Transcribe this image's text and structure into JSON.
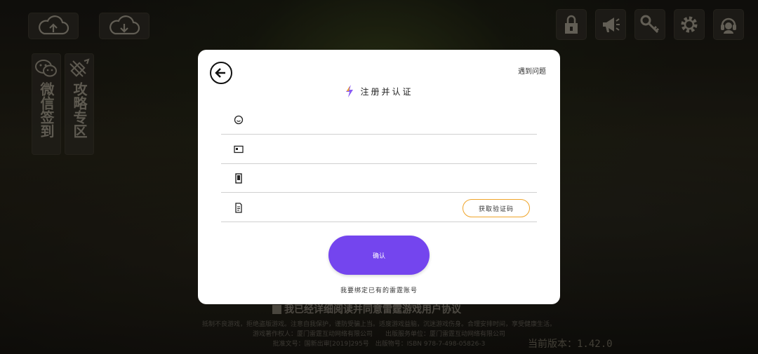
{
  "background": {
    "upload_icon": "cloud-upload-icon",
    "download_icon": "cloud-download-icon",
    "top_icons": [
      "lock-icon",
      "megaphone-icon",
      "key-icon",
      "gear-icon",
      "headset-icon"
    ],
    "side_panels": [
      {
        "icon": "wechat-icon",
        "label": "微信签到"
      },
      {
        "icon": "strategy-icon",
        "label": "攻略专区"
      }
    ],
    "agreement_text": "我已经详细阅读并同意雷霆游戏用户协议",
    "footer_lines": [
      "抵制不良游戏，拒绝盗版游戏。注意自我保护，谨防受骗上当。适度游戏益脑，沉迷游戏伤身。合理安排时间，享受健康生活。",
      "游戏著作权人：厦门雷霆互动网络有限公司　　出版服务单位：厦门雷霆互动网络有限公司",
      "批准文号：国新出审[2019]295号　出版物号：ISBN 978-7-498-05826-3"
    ],
    "version": "当前版本：1.42.0"
  },
  "dialog": {
    "help_link": "遇到问题",
    "title": "注册并认证",
    "title_icon": "lightning-icon",
    "fields": [
      {
        "icon": "smiley-icon",
        "value": "",
        "placeholder": ""
      },
      {
        "icon": "id-card-icon",
        "value": "",
        "placeholder": ""
      },
      {
        "icon": "phone-icon",
        "value": "",
        "placeholder": ""
      },
      {
        "icon": "document-icon",
        "value": "",
        "placeholder": ""
      }
    ],
    "get_code_label": "获取验证码",
    "confirm_label": "确认",
    "existing_account": "我要绑定已有的雷霆账号"
  },
  "colors": {
    "accent_purple": "#7445ee",
    "code_button_border": "#f0a52a"
  }
}
